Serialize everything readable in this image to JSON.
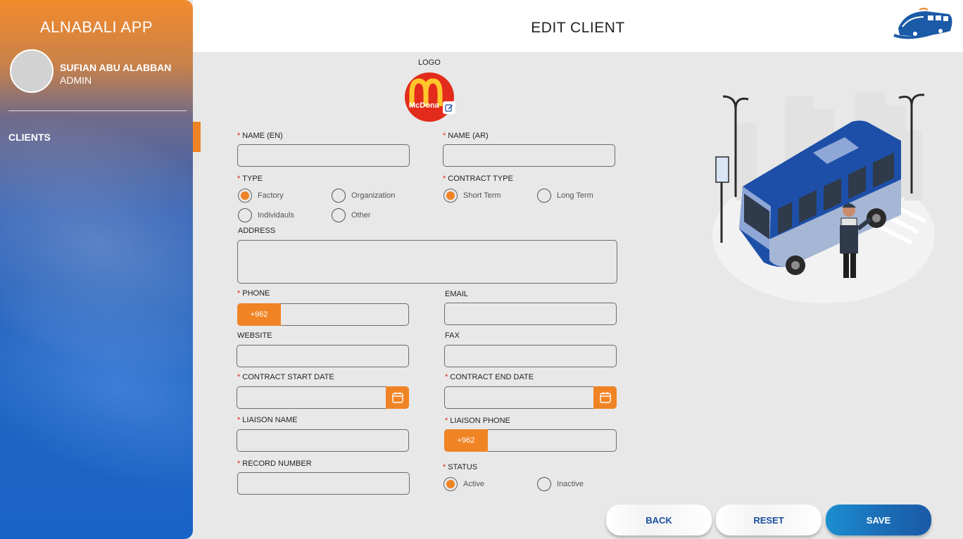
{
  "app": {
    "title": "ALNABALI APP"
  },
  "user": {
    "name": "SUFIAN ABU ALABBAN",
    "role": "ADMIN"
  },
  "sidebar": {
    "items": [
      {
        "label": "CLIENTS",
        "active": true
      }
    ]
  },
  "header": {
    "title": "EDIT CLIENT",
    "brand_icon": "bus-logo-icon"
  },
  "form": {
    "logo_label": "LOGO",
    "logo_icon": "mcdonalds-logo",
    "logo_text": "McDona",
    "name_en": {
      "label": "NAME (EN)",
      "value": ""
    },
    "name_ar": {
      "label": "NAME (AR)",
      "value": ""
    },
    "type": {
      "label": "TYPE",
      "options": [
        "Factory",
        "Organization",
        "Individauls",
        "Other"
      ],
      "selected": "Factory"
    },
    "contract_type": {
      "label": "CONTRACT TYPE",
      "options": [
        "Short Term",
        "Long Term"
      ],
      "selected": "Short Term"
    },
    "address": {
      "label": "ADDRESS",
      "value": ""
    },
    "phone": {
      "label": "PHONE",
      "prefix": "+962",
      "value": ""
    },
    "email": {
      "label": "EMAIL",
      "value": ""
    },
    "website": {
      "label": "WEBSITE",
      "value": ""
    },
    "fax": {
      "label": "FAX",
      "value": ""
    },
    "contract_start_date": {
      "label": "CONTRACT START DATE",
      "value": ""
    },
    "contract_end_date": {
      "label": "CONTRACT END DATE",
      "value": ""
    },
    "liaison_name": {
      "label": "LIAISON NAME",
      "value": ""
    },
    "liaison_phone": {
      "label": "LIAISON PHONE",
      "prefix": "+962",
      "value": ""
    },
    "record_number": {
      "label": "RECORD NUMBER",
      "value": ""
    },
    "status": {
      "label": "STATUS",
      "options": [
        "Active",
        "Inactive"
      ],
      "selected": "Active"
    }
  },
  "actions": {
    "back": "BACK",
    "reset": "RESET",
    "save": "SAVE"
  },
  "colors": {
    "accent": "#f08425",
    "primary": "#1b6fb8",
    "required": "#e02020"
  }
}
